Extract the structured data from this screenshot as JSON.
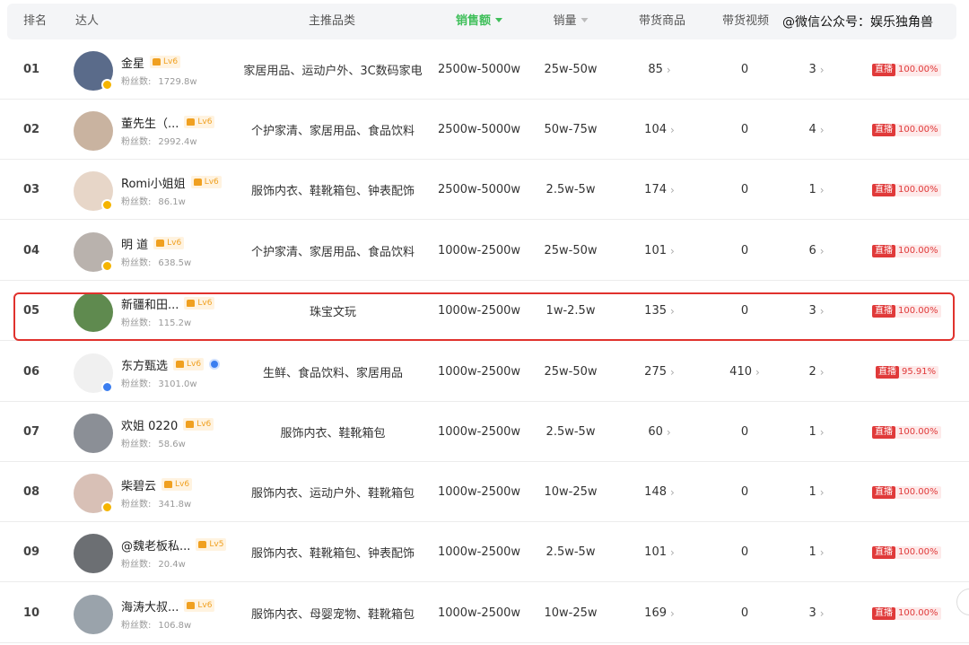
{
  "watermark": "@微信公众号：娱乐独角兽",
  "header": {
    "rank": "排名",
    "creator": "达人",
    "category": "主推品类",
    "sales_amount": "销售额",
    "sales_volume": "销量",
    "products": "带货商品",
    "videos": "带货视频"
  },
  "fans_label": "粉丝数:",
  "live_label": "直播",
  "rows": [
    {
      "rank": "01",
      "name": "金星",
      "lv": "Lv6",
      "fans": "1729.8w",
      "category": "家居用品、运动户外、3C数码家电",
      "sales": "2500w-5000w",
      "volume": "25w-50w",
      "products": "85",
      "videos": "0",
      "lives": "3",
      "live_pct": "100.00%"
    },
    {
      "rank": "02",
      "name": "董先生（...",
      "lv": "Lv6",
      "fans": "2992.4w",
      "category": "个护家清、家居用品、食品饮料",
      "sales": "2500w-5000w",
      "volume": "50w-75w",
      "products": "104",
      "videos": "0",
      "lives": "4",
      "live_pct": "100.00%"
    },
    {
      "rank": "03",
      "name": "Romi小姐姐",
      "lv": "Lv6",
      "fans": "86.1w",
      "category": "服饰内衣、鞋靴箱包、钟表配饰",
      "sales": "2500w-5000w",
      "volume": "2.5w-5w",
      "products": "174",
      "videos": "0",
      "lives": "1",
      "live_pct": "100.00%"
    },
    {
      "rank": "04",
      "name": "明 道",
      "lv": "Lv6",
      "fans": "638.5w",
      "category": "个护家清、家居用品、食品饮料",
      "sales": "1000w-2500w",
      "volume": "25w-50w",
      "products": "101",
      "videos": "0",
      "lives": "6",
      "live_pct": "100.00%"
    },
    {
      "rank": "05",
      "name": "新疆和田...",
      "lv": "Lv6",
      "fans": "115.2w",
      "category": "珠宝文玩",
      "sales": "1000w-2500w",
      "volume": "1w-2.5w",
      "products": "135",
      "videos": "0",
      "lives": "3",
      "live_pct": "100.00%"
    },
    {
      "rank": "06",
      "name": "东方甄选",
      "lv": "Lv6",
      "fans": "3101.0w",
      "category": "生鲜、食品饮料、家居用品",
      "sales": "1000w-2500w",
      "volume": "25w-50w",
      "products": "275",
      "videos": "410",
      "lives": "2",
      "live_pct": "95.91%"
    },
    {
      "rank": "07",
      "name": "欢姐 0220",
      "lv": "Lv6",
      "fans": "58.6w",
      "category": "服饰内衣、鞋靴箱包",
      "sales": "1000w-2500w",
      "volume": "2.5w-5w",
      "products": "60",
      "videos": "0",
      "lives": "1",
      "live_pct": "100.00%"
    },
    {
      "rank": "08",
      "name": "柴碧云",
      "lv": "Lv6",
      "fans": "341.8w",
      "category": "服饰内衣、运动户外、鞋靴箱包",
      "sales": "1000w-2500w",
      "volume": "10w-25w",
      "products": "148",
      "videos": "0",
      "lives": "1",
      "live_pct": "100.00%"
    },
    {
      "rank": "09",
      "name": "@魏老板私...",
      "lv": "Lv5",
      "fans": "20.4w",
      "category": "服饰内衣、鞋靴箱包、钟表配饰",
      "sales": "1000w-2500w",
      "volume": "2.5w-5w",
      "products": "101",
      "videos": "0",
      "lives": "1",
      "live_pct": "100.00%"
    },
    {
      "rank": "10",
      "name": "海涛大叔...",
      "lv": "Lv6",
      "fans": "106.8w",
      "category": "服饰内衣、母婴宠物、鞋靴箱包",
      "sales": "1000w-2500w",
      "volume": "10w-25w",
      "products": "169",
      "videos": "0",
      "lives": "3",
      "live_pct": "100.00%"
    }
  ]
}
